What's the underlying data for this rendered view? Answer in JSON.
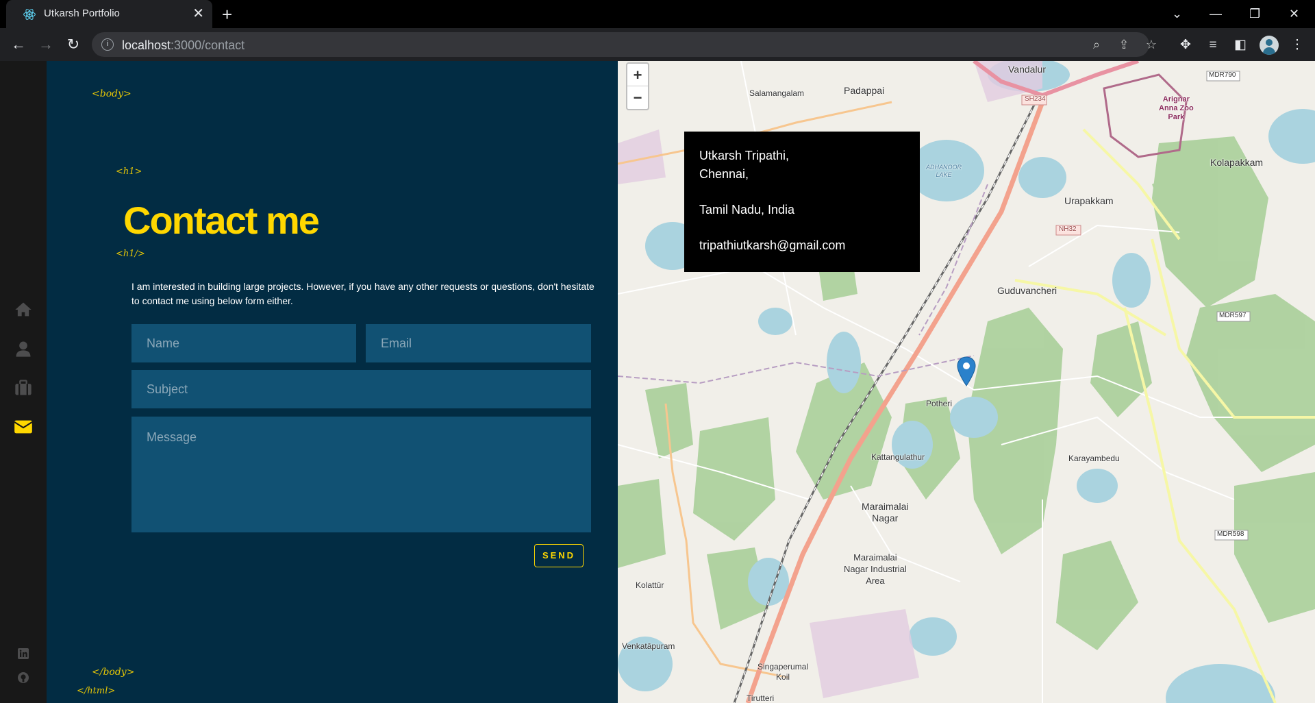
{
  "browser": {
    "tab_title": "Utkarsh Portfolio",
    "url_host": "localhost",
    "url_path": ":3000/contact"
  },
  "sidebar": {
    "items": [
      {
        "name": "home",
        "active": false
      },
      {
        "name": "about",
        "active": false
      },
      {
        "name": "portfolio",
        "active": false
      },
      {
        "name": "contact",
        "active": true
      }
    ],
    "accent": "#ffd700",
    "icon_color": "#4d4d4e"
  },
  "tags": {
    "body_open": "<body>",
    "h1_open": "<h1>",
    "h1_close": "<h1/>",
    "body_close": "</body>",
    "html_close": "</html>"
  },
  "contact": {
    "heading": "Contact me",
    "intro": "I am interested in building large projects. However, if you have any other requests or questions, don't hesitate to contact me using below form either.",
    "form": {
      "name_placeholder": "Name",
      "email_placeholder": "Email",
      "subject_placeholder": "Subject",
      "message_placeholder": "Message",
      "send_label": "SEND"
    }
  },
  "map": {
    "zoom_in": "+",
    "zoom_out": "−",
    "info": {
      "line1": "Utkarsh Tripathi,",
      "line2": "Chennai,",
      "line3": "Tamil Nadu, India",
      "email": "tripathiutkarsh@gmail.com"
    },
    "places": {
      "salamangalam": "Salamangalam",
      "padappai": "Padappai",
      "vandalur": "Vandalur",
      "zoo": "Arignar\nAnna Zoo\nPark",
      "kolapakkam": "Kolapakkam",
      "urapakkam": "Urapakkam",
      "guduvancheri": "Guduvancheri",
      "potheri": "Potheri",
      "kattangulathur": "Kattangulathur",
      "karayambedu": "Karayambedu",
      "maraimalai": "Maraimalai\nNagar",
      "industrial": "Maraimalai\nNagar Industrial\nArea",
      "kolattur": "Kolattūr",
      "venkatapuram": "Venkatāpuram",
      "singaperumal": "Singaperumal\nKoil",
      "tirutteri": "Tirutteri",
      "adhanoor": "ADHANOOR\nLAKE",
      "mdr790": "MDR790",
      "sh234": "SH234",
      "nh32": "NH32",
      "mdr597": "MDR597",
      "mdr598": "MDR598"
    }
  }
}
